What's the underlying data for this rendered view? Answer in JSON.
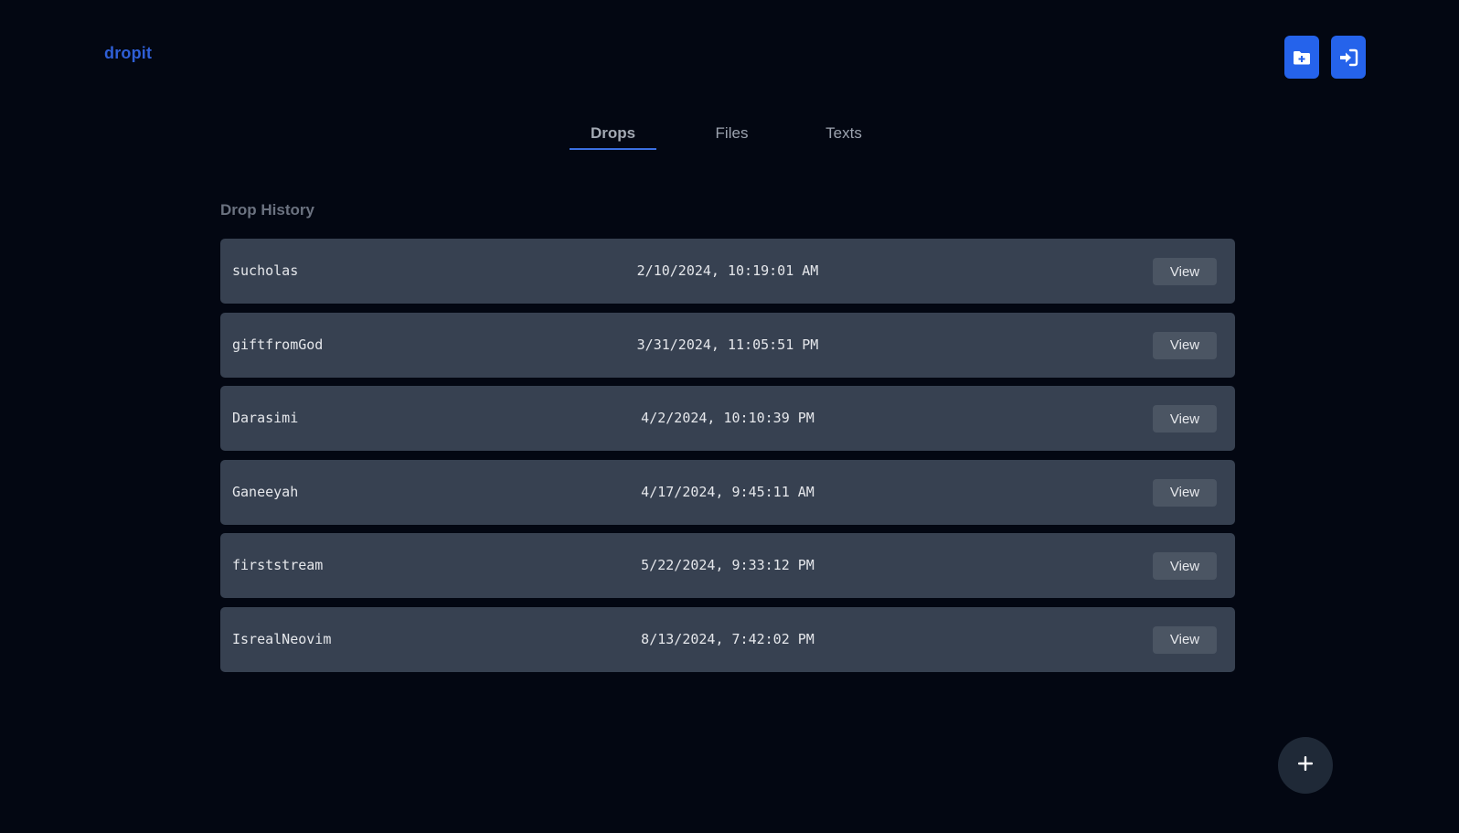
{
  "app": {
    "logo": "dropit",
    "accent_color": "#2563eb",
    "background_color": "#030712"
  },
  "header": {
    "actions": [
      {
        "icon": "folder-plus-icon",
        "label": "new-folder"
      },
      {
        "icon": "sign-in-icon",
        "label": "sign-in"
      }
    ]
  },
  "tabs": [
    {
      "label": "Drops",
      "active": true
    },
    {
      "label": "Files",
      "active": false
    },
    {
      "label": "Texts",
      "active": false
    }
  ],
  "history": {
    "title": "Drop History",
    "view_label": "View",
    "rows": [
      {
        "name": "sucholas",
        "date": "2/10/2024, 10:19:01 AM"
      },
      {
        "name": "giftfromGod",
        "date": "3/31/2024, 11:05:51 PM"
      },
      {
        "name": "Darasimi",
        "date": "4/2/2024, 10:10:39 PM"
      },
      {
        "name": "Ganeeyah",
        "date": "4/17/2024, 9:45:11 AM"
      },
      {
        "name": "firststream",
        "date": "5/22/2024, 9:33:12 PM"
      },
      {
        "name": "IsrealNeovim",
        "date": "8/13/2024, 7:42:02 PM"
      }
    ]
  },
  "fab": {
    "icon": "plus-icon"
  }
}
